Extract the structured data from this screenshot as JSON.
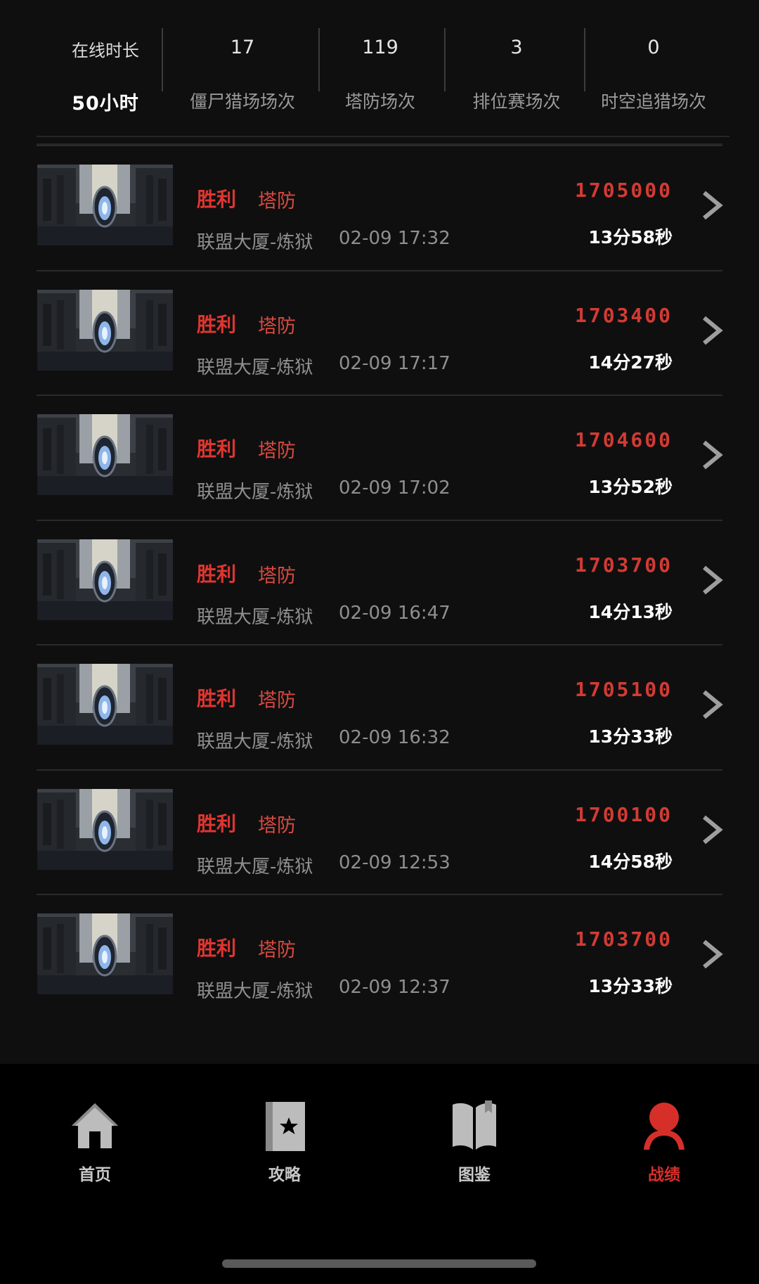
{
  "stats": {
    "online_label": "在线时长",
    "online_value": "50小时",
    "items": [
      {
        "value": "17",
        "label": "僵尸猎场场次"
      },
      {
        "value": "119",
        "label": "塔防场次"
      },
      {
        "value": "3",
        "label": "排位赛场次"
      },
      {
        "value": "0",
        "label": "时空追猎场次"
      }
    ]
  },
  "matches": [
    {
      "result": "胜利",
      "mode": "塔防",
      "map": "联盟大厦-炼狱",
      "datetime": "02-09 17:32",
      "score": "1705000",
      "duration": "13分58秒"
    },
    {
      "result": "胜利",
      "mode": "塔防",
      "map": "联盟大厦-炼狱",
      "datetime": "02-09 17:17",
      "score": "1703400",
      "duration": "14分27秒"
    },
    {
      "result": "胜利",
      "mode": "塔防",
      "map": "联盟大厦-炼狱",
      "datetime": "02-09 17:02",
      "score": "1704600",
      "duration": "13分52秒"
    },
    {
      "result": "胜利",
      "mode": "塔防",
      "map": "联盟大厦-炼狱",
      "datetime": "02-09 16:47",
      "score": "1703700",
      "duration": "14分13秒"
    },
    {
      "result": "胜利",
      "mode": "塔防",
      "map": "联盟大厦-炼狱",
      "datetime": "02-09 16:32",
      "score": "1705100",
      "duration": "13分33秒"
    },
    {
      "result": "胜利",
      "mode": "塔防",
      "map": "联盟大厦-炼狱",
      "datetime": "02-09 12:53",
      "score": "1700100",
      "duration": "14分58秒"
    },
    {
      "result": "胜利",
      "mode": "塔防",
      "map": "联盟大厦-炼狱",
      "datetime": "02-09 12:37",
      "score": "1703700",
      "duration": "13分33秒"
    }
  ],
  "nav": {
    "items": [
      {
        "label": "首页",
        "icon": "home-icon"
      },
      {
        "label": "攻略",
        "icon": "guide-book-star-icon"
      },
      {
        "label": "图鉴",
        "icon": "open-book-icon"
      },
      {
        "label": "战绩",
        "icon": "profile-icon"
      }
    ],
    "active": "战绩"
  },
  "colors": {
    "accent_red": "#d62f2a",
    "background": "#0f0f10",
    "nav_background": "#000000"
  }
}
